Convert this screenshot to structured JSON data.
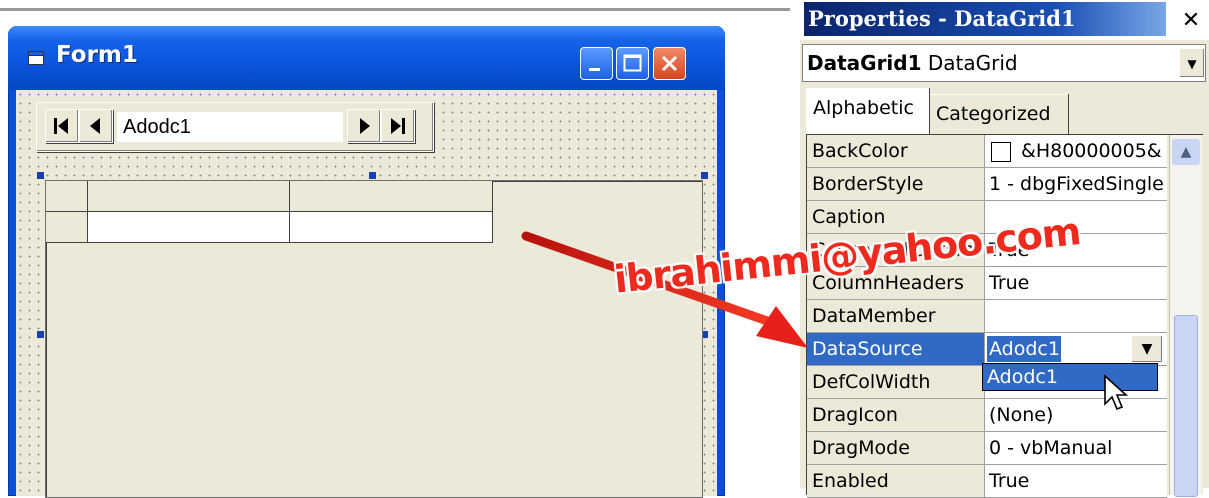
{
  "form": {
    "title": "Form1",
    "adodc_caption": "Adodc1",
    "nav": {
      "first": "first-record",
      "prev": "previous-record",
      "next": "next-record",
      "last": "last-record"
    }
  },
  "properties": {
    "title": "Properties - DataGrid1",
    "close_glyph": "✕",
    "object_name": "DataGrid1",
    "object_type": "DataGrid",
    "tabs": [
      "Alphabetic",
      "Categorized"
    ],
    "rows": [
      {
        "name": "BackColor",
        "value": "&H80000005&"
      },
      {
        "name": "BorderStyle",
        "value": "1 - dbgFixedSingle"
      },
      {
        "name": "Caption",
        "value": ""
      },
      {
        "name": "CausesValidation",
        "value": "True"
      },
      {
        "name": "ColumnHeaders",
        "value": "True"
      },
      {
        "name": "DataMember",
        "value": ""
      },
      {
        "name": "DataSource",
        "value": "Adodc1"
      },
      {
        "name": "DefColWidth",
        "value": ""
      },
      {
        "name": "DragIcon",
        "value": "(None)"
      },
      {
        "name": "DragMode",
        "value": "0 - vbManual"
      },
      {
        "name": "Enabled",
        "value": "True"
      }
    ],
    "dropdown_option": "Adodc1"
  },
  "overlay": {
    "watermark": "ibrahimmi@yahoo.com",
    "arrow_color": "#e8201a"
  },
  "colors": {
    "xp_title_blue": "#0a54dc",
    "selection": "#316ac5",
    "face": "#ece9d8"
  },
  "icons": [
    "form-icon",
    "minimize-icon",
    "maximize-icon",
    "close-icon",
    "first-record-icon",
    "prev-record-icon",
    "next-record-icon",
    "last-record-icon",
    "dropdown-arrow-icon",
    "scroll-up-icon",
    "mouse-cursor-icon"
  ]
}
